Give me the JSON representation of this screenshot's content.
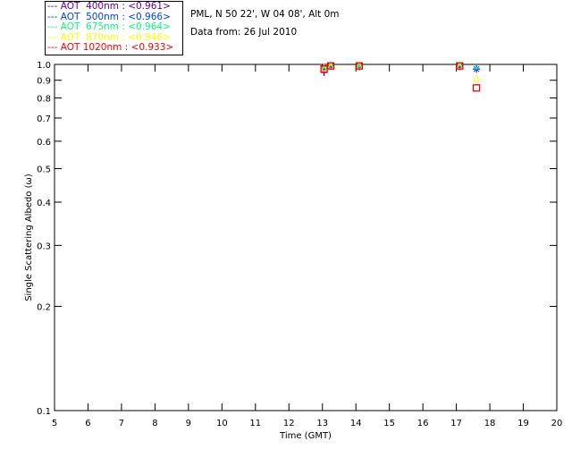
{
  "header": {
    "location": "PML, N 50 22', W 04 08', Alt 0m",
    "date": "Data from: 26 Jul 2010"
  },
  "chart_data": {
    "type": "scatter",
    "xlabel": "Time (GMT)",
    "ylabel": "Single Scattering Albedo (ω)",
    "xlim": [
      5,
      20
    ],
    "ylim": [
      0.1,
      1.0
    ],
    "yscale": "log",
    "grid": false,
    "legend_placement": "top-left",
    "x_ticks": [
      "5",
      "6",
      "7",
      "8",
      "9",
      "10",
      "11",
      "12",
      "13",
      "14",
      "15",
      "16",
      "17",
      "18",
      "19",
      "20"
    ],
    "y_ticks": [
      "0.1",
      "0.2",
      "0.3",
      "0.4",
      "0.5",
      "0.6",
      "0.7",
      "0.8",
      "0.9",
      "1.0"
    ],
    "series": [
      {
        "name": "AOT  400nm : <0.961>",
        "color": "#6000b0",
        "marker": "plus",
        "x": [
          13.05,
          13.25,
          14.1,
          17.1,
          17.6
        ],
        "y": [
          0.948,
          0.99,
          0.985,
          0.985,
          0.97
        ]
      },
      {
        "name": "AOT  500nm : <0.966>",
        "color": "#0040ff",
        "marker": "asterisk",
        "x": [
          13.05,
          13.25,
          14.1,
          17.1,
          17.6
        ],
        "y": [
          0.975,
          0.99,
          0.99,
          0.99,
          0.97
        ]
      },
      {
        "name": "AOT  675nm : <0.964>",
        "color": "#00ff80",
        "marker": "dot",
        "x": [
          13.05,
          13.25,
          14.1,
          17.1,
          17.6
        ],
        "y": [
          0.98,
          0.995,
          0.99,
          0.995,
          0.975
        ]
      },
      {
        "name": "AOT  870nm : <0.946>",
        "color": "#ffff00",
        "marker": "triangle",
        "x": [
          13.05,
          13.25,
          14.1,
          17.1,
          17.6
        ],
        "y": [
          0.975,
          0.99,
          0.99,
          0.99,
          0.91
        ]
      },
      {
        "name": "AOT 1020nm : <0.933>",
        "color": "#ff0000",
        "marker": "square",
        "x": [
          13.05,
          13.25,
          14.1,
          17.1,
          17.6
        ],
        "y": [
          0.97,
          0.99,
          0.99,
          0.99,
          0.855
        ]
      }
    ]
  }
}
